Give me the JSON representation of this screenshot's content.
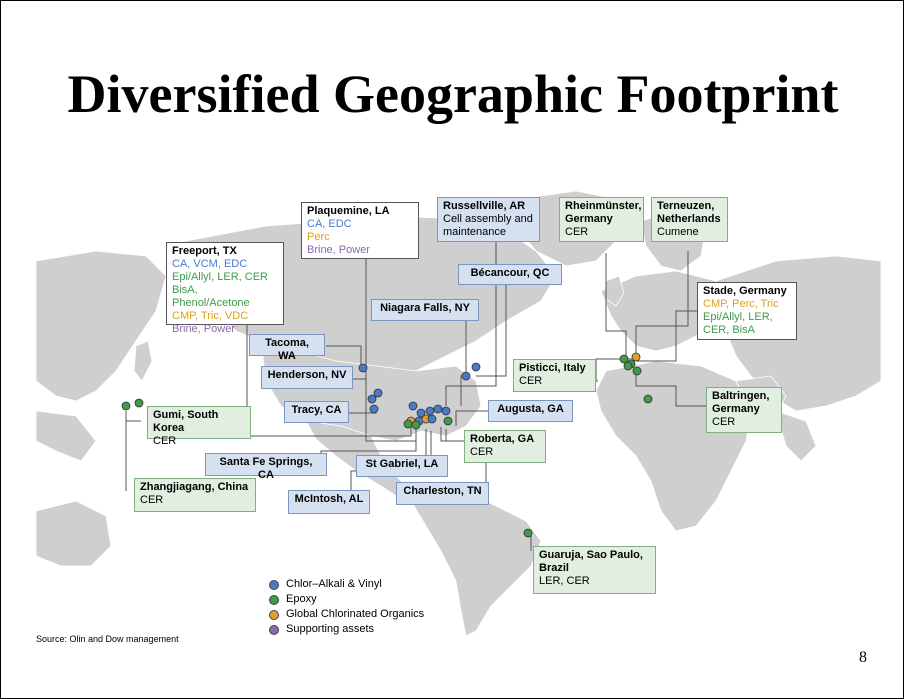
{
  "title": "Diversified Geographic Footprint",
  "page_number": "8",
  "source": "Source: Olin and Dow management",
  "colors": {
    "chlor_alkali": "#4a79c6",
    "epoxy": "#3f9a4b",
    "chlorinated": "#e0a030",
    "supporting": "#8a6aa8"
  },
  "legend": [
    {
      "label": "Chlor–Alkali & Vinyl",
      "color": "#4a79c6"
    },
    {
      "label": "Epoxy",
      "color": "#3f9a4b"
    },
    {
      "label": "Global Chlorinated Organics",
      "color": "#e0a030"
    },
    {
      "label": "Supporting assets",
      "color": "#8a6aa8"
    }
  ],
  "boxes": {
    "freeport": {
      "title": "Freeport, TX",
      "l1": "CA, VCM, EDC",
      "l2": "Epi/Allyl, LER, CER",
      "l3": "BisA, Phenol/Acetone",
      "l4": "CMP, Tric, VDC",
      "l5": "Brine, Power"
    },
    "plaquemine": {
      "title": "Plaquemine, LA",
      "l1": "CA, EDC",
      "l2": "Perc",
      "l3": "Brine, Power"
    },
    "russellville": {
      "title": "Russellville, AR",
      "l1": "Cell assembly and",
      "l2": "maintenance"
    },
    "becancour": {
      "title": "Bécancour, QC"
    },
    "niagara": {
      "title": "Niagara Falls, NY"
    },
    "tacoma": {
      "title": "Tacoma, WA"
    },
    "henderson": {
      "title": "Henderson, NV"
    },
    "tracy": {
      "title": "Tracy, CA"
    },
    "santafe": {
      "title": "Santa Fe Springs, CA"
    },
    "mcintosh": {
      "title": "McIntosh, AL"
    },
    "stgabriel": {
      "title": "St Gabriel, LA"
    },
    "charleston": {
      "title": "Charleston, TN"
    },
    "augusta": {
      "title": "Augusta, GA"
    },
    "roberta": {
      "title": "Roberta, GA",
      "l1": "CER"
    },
    "pisticci": {
      "title": "Pisticci, Italy",
      "l1": "CER"
    },
    "rheinmunster": {
      "title": "Rheinmünster,",
      "title2": "Germany",
      "l1": "CER"
    },
    "terneuzen": {
      "title": "Terneuzen,",
      "title2": "Netherlands",
      "l1": "Cumene"
    },
    "stade": {
      "title": "Stade, Germany",
      "l1": "CMP, Perc, Tric",
      "l2": "Epi/Allyl, LER,",
      "l3": "CER, BisA"
    },
    "baltringen": {
      "title": "Baltringen,",
      "title2": "Germany",
      "l1": "CER"
    },
    "gumi": {
      "title": "Gumi, South Korea",
      "l1": "CER"
    },
    "zhangjiagang": {
      "title": "Zhangjiagang, China",
      "l1": "CER"
    },
    "guaruja": {
      "title": "Guaruja, Sao Paulo,",
      "title2": "Brazil",
      "l1": "LER, CER"
    }
  }
}
